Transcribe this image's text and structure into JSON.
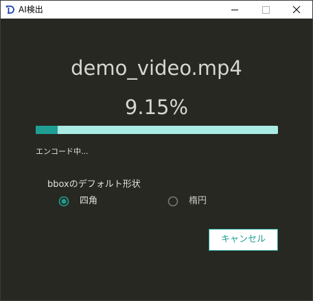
{
  "window": {
    "title": "AI検出",
    "icon": "app-logo-icon"
  },
  "file": {
    "name": "demo_video.mp4"
  },
  "progress": {
    "percent_text": "9.15%",
    "value": 0.0915,
    "status": "エンコード中..."
  },
  "bbox": {
    "label": "bboxのデフォルト形状",
    "options": [
      {
        "label": "四角",
        "selected": true
      },
      {
        "label": "楕円",
        "selected": false
      }
    ]
  },
  "actions": {
    "cancel_label": "キャンセル"
  },
  "colors": {
    "background": "#272822",
    "accent": "#1f9e94",
    "progress_track": "#a8ece4",
    "text": "#d6d6d2"
  }
}
